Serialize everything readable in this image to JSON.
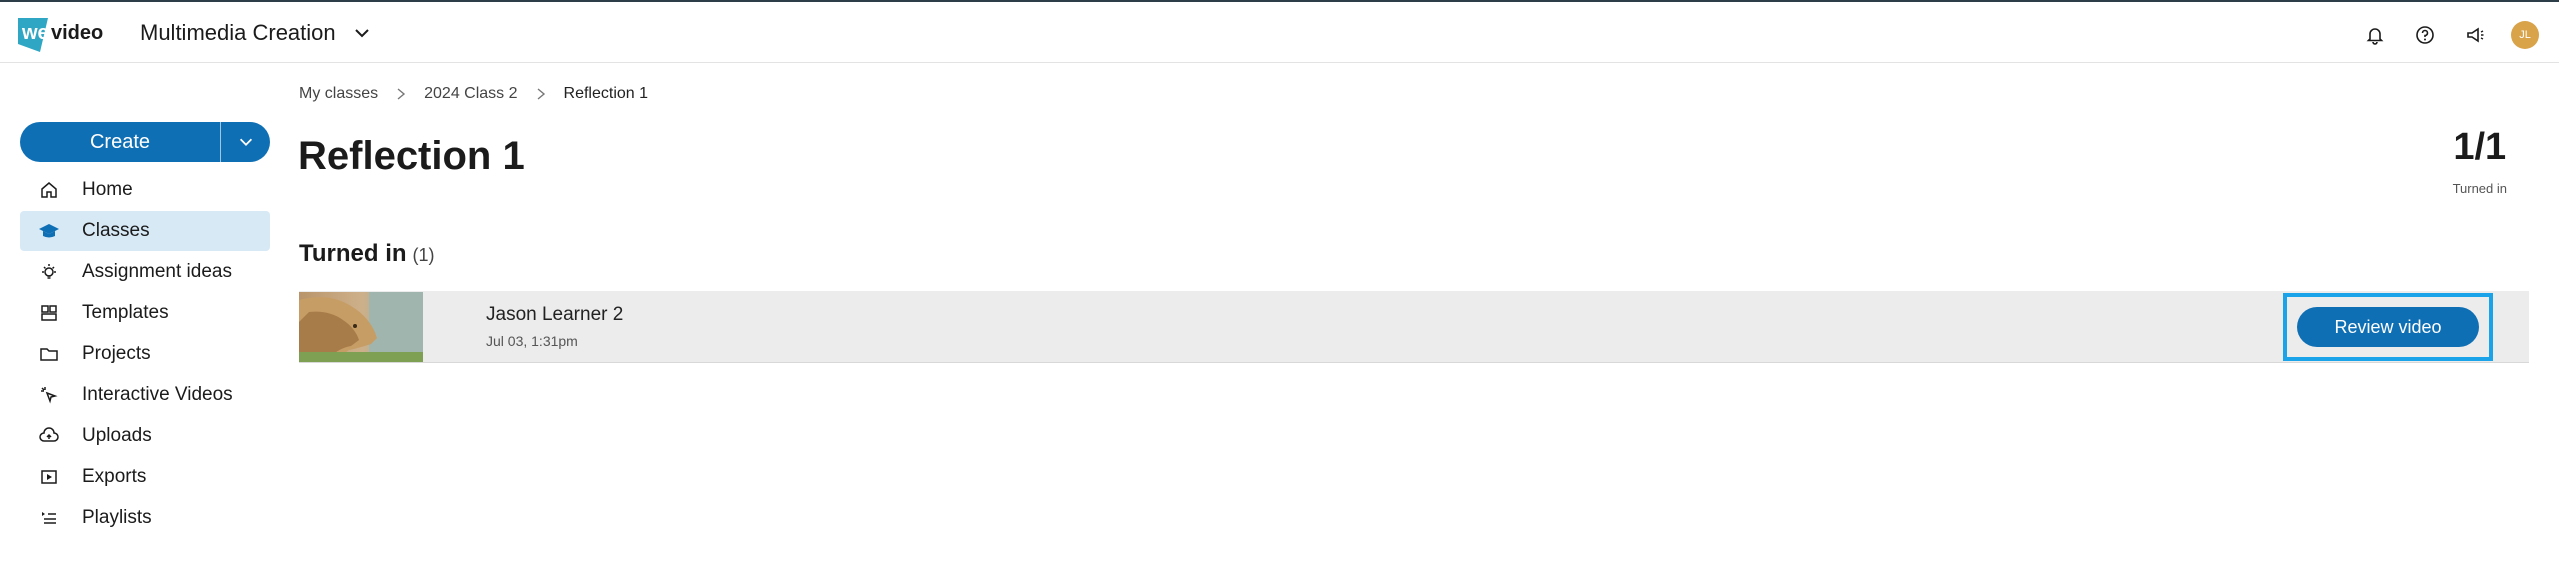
{
  "header": {
    "logo_text": "wevideo",
    "workspace": "Multimedia Creation",
    "icons": [
      "bell-icon",
      "help-icon",
      "megaphone-icon"
    ],
    "avatar_initials": "JL"
  },
  "sidebar": {
    "create_label": "Create",
    "items": [
      {
        "label": "Home",
        "icon": "home-icon"
      },
      {
        "label": "Classes",
        "icon": "classes-icon",
        "active": true
      },
      {
        "label": "Assignment ideas",
        "icon": "lightbulb-icon"
      },
      {
        "label": "Templates",
        "icon": "templates-icon"
      },
      {
        "label": "Projects",
        "icon": "folder-icon"
      },
      {
        "label": "Interactive Videos",
        "icon": "interactive-icon"
      },
      {
        "label": "Uploads",
        "icon": "upload-icon"
      },
      {
        "label": "Exports",
        "icon": "exports-icon"
      },
      {
        "label": "Playlists",
        "icon": "playlist-icon"
      }
    ]
  },
  "breadcrumb": [
    "My classes",
    "2024 Class 2",
    "Reflection 1"
  ],
  "page": {
    "title": "Reflection 1",
    "count_value": "1/1",
    "count_label": "Turned in"
  },
  "section": {
    "title": "Turned in",
    "count": "(1)"
  },
  "submissions": [
    {
      "name": "Jason Learner 2",
      "date": "Jul 03, 1:31pm",
      "action": "Review video"
    }
  ],
  "colors": {
    "accent": "#0f6fb5",
    "active_nav": "#d8e9f6",
    "highlight_border": "#1aa3e8",
    "logo_teal": "#2fa7c4"
  }
}
